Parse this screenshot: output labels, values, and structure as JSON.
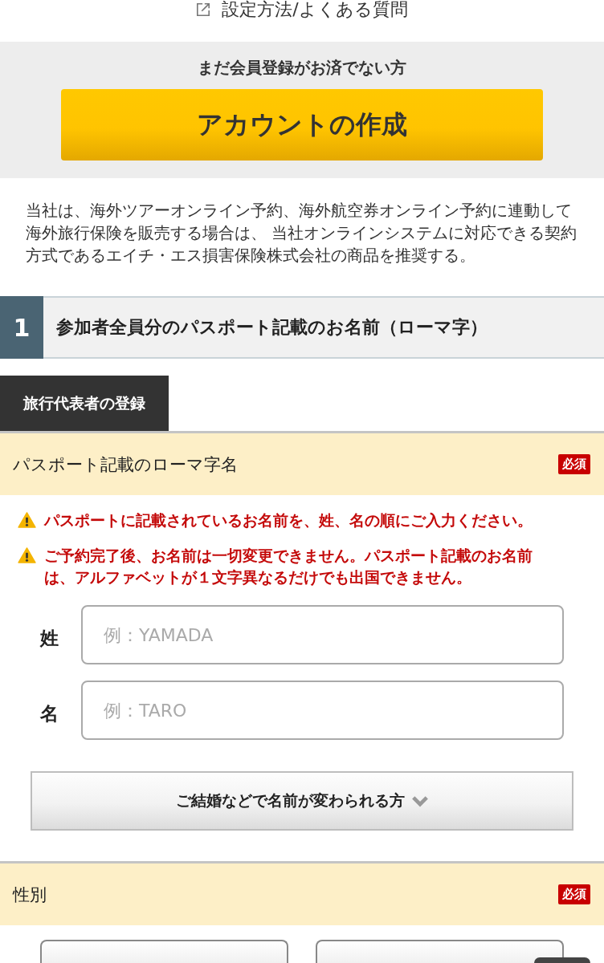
{
  "help_link": {
    "label": "設定方法/よくある質問"
  },
  "signup": {
    "heading": "まだ会員登録がお済でない方",
    "button": "アカウントの作成"
  },
  "notice": {
    "lines": [
      "当社は、海外ツアーオンライン予約、海外航空券オンライン予約に連動して",
      "海外旅行保険を販売する場合は、 当社オンラインシステムに対応できる契約",
      "方式であるエイチ・エス損害保険株式会社の商品を推奨する。"
    ]
  },
  "step": {
    "number": "1",
    "title": "参加者全員分のパスポート記載のお名前（ローマ字）"
  },
  "subsection": {
    "label": "旅行代表者の登録"
  },
  "fields": [
    {
      "kind": "name",
      "title": "パスポート記載のローマ字名",
      "badge": "必須",
      "warnings": [
        {
          "lines": [
            "パスポートに記載されているお名前を、姓、名の順にご入力ください。"
          ]
        },
        {
          "lines": [
            "ご予約完了後、お名前は一切変更できません。パスポート記載のお名前",
            "は、アルファベットが１文字異なるだけでも出国できません。"
          ]
        }
      ],
      "inputs": [
        {
          "label": "姓",
          "placeholder": "例：YAMADA"
        },
        {
          "label": "名",
          "placeholder": "例：TARO"
        }
      ],
      "expand_button": {
        "label": "ご結婚などで名前が変わられる方",
        "expanded": false
      }
    },
    {
      "kind": "choice",
      "title": "性別",
      "badge": "必須"
    }
  ]
}
